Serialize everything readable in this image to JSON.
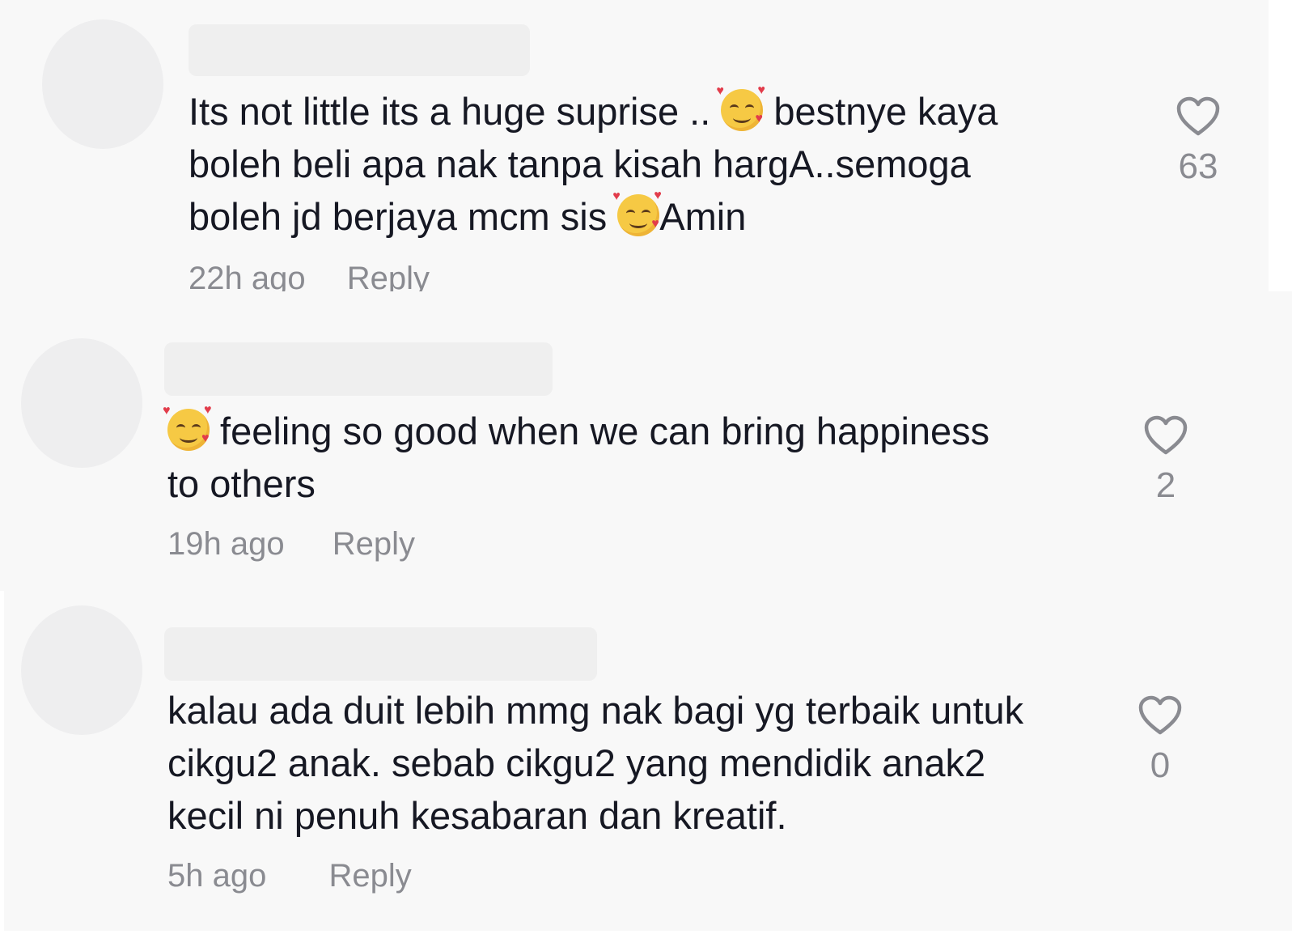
{
  "comments": [
    {
      "text_before": "Its not little its a huge suprise .. ",
      "text_middle": " bestnye kaya\nboleh beli apa nak tanpa kisah hargA..semoga\nboleh jd berjaya mcm sis ",
      "text_after": "Amin",
      "time": "22h ago",
      "reply_label": "Reply",
      "likes": "63"
    },
    {
      "text_before": "",
      "text_middle": " feeling so good when we can bring happiness\nto others",
      "text_after": "",
      "time": "19h ago",
      "reply_label": "Reply",
      "likes": "2"
    },
    {
      "text_before": "kalau ada duit lebih mmg nak bagi yg terbaik untuk\ncikgu2 anak. sebab cikgu2 yang mendidik anak2\nkecil ni penuh kesabaran dan kreatif.",
      "time": "5h ago",
      "reply_label": "Reply",
      "likes": "0"
    }
  ],
  "icons": {
    "emoji": "smiling-face-with-hearts-icon",
    "like": "heart-outline-icon"
  },
  "colors": {
    "background": "#f8f8f8",
    "text": "#161823",
    "meta_text": "#8a8b91",
    "placeholder": "#eeeeef"
  }
}
